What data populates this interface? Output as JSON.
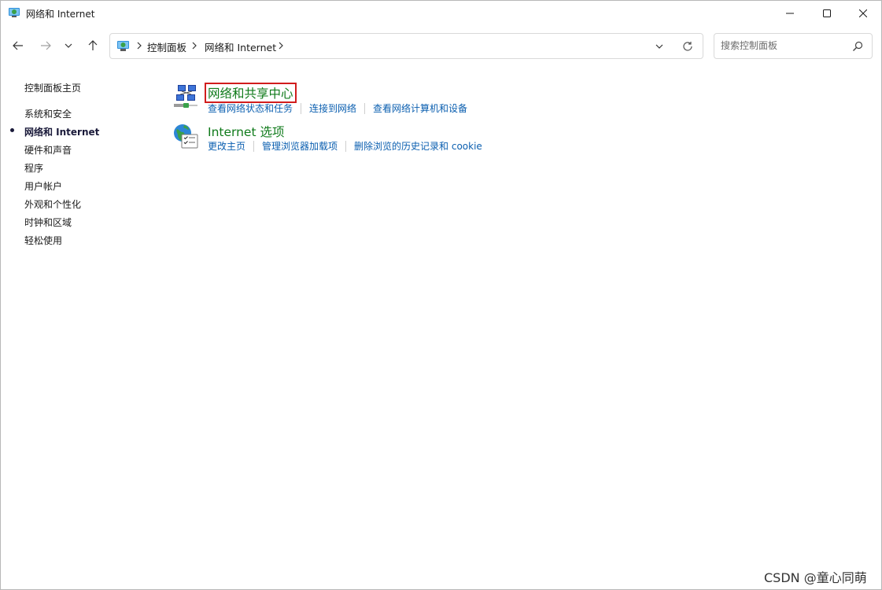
{
  "window": {
    "title": "网络和 Internet",
    "controls": {
      "minimize": "minimize-icon",
      "maximize": "maximize-icon",
      "close": "close-icon"
    }
  },
  "navigation": {
    "back": "back-arrow-icon",
    "forward": "forward-arrow-icon",
    "recent": "chevron-down-icon",
    "up": "up-arrow-icon",
    "breadcrumb": [
      "控制面板",
      "网络和 Internet"
    ],
    "refresh": "refresh-icon"
  },
  "search": {
    "placeholder": "搜索控制面板",
    "value": ""
  },
  "sidebar": {
    "home": "控制面板主页",
    "items": [
      {
        "label": "系统和安全",
        "active": false
      },
      {
        "label": "网络和 Internet",
        "active": true
      },
      {
        "label": "硬件和声音",
        "active": false
      },
      {
        "label": "程序",
        "active": false
      },
      {
        "label": "用户帐户",
        "active": false
      },
      {
        "label": "外观和个性化",
        "active": false
      },
      {
        "label": "时钟和区域",
        "active": false
      },
      {
        "label": "轻松使用",
        "active": false
      }
    ]
  },
  "categories": [
    {
      "title": "网络和共享中心",
      "icon": "network-sharing-icon",
      "highlighted": true,
      "links": [
        "查看网络状态和任务",
        "连接到网络",
        "查看网络计算机和设备"
      ]
    },
    {
      "title": "Internet 选项",
      "icon": "internet-options-icon",
      "highlighted": false,
      "links": [
        "更改主页",
        "管理浏览器加载项",
        "删除浏览的历史记录和 cookie"
      ]
    }
  ],
  "watermark": "CSDN @童心同萌",
  "colors": {
    "title_green": "#0f7a1a",
    "link_blue": "#0b5fb0",
    "highlight_red": "#d11d1d"
  }
}
